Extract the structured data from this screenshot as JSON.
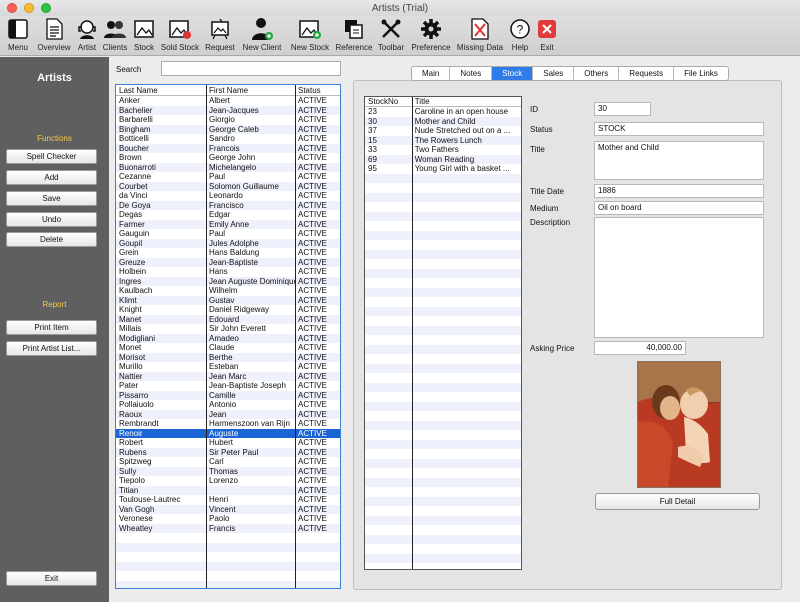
{
  "window": {
    "title": "Artists (Trial)"
  },
  "toolbar": [
    {
      "label": "Menu",
      "icon": "menu-icon"
    },
    {
      "label": "Overview",
      "icon": "overview-icon"
    },
    {
      "label": "Artist",
      "icon": "artist-icon"
    },
    {
      "label": "Clients",
      "icon": "clients-icon"
    },
    {
      "label": "Stock",
      "icon": "stock-icon"
    },
    {
      "label": "Sold Stock",
      "icon": "sold-stock-icon"
    },
    {
      "label": "Request",
      "icon": "request-icon"
    },
    {
      "label": "New Client",
      "icon": "new-client-icon"
    },
    {
      "label": "New Stock",
      "icon": "new-stock-icon"
    },
    {
      "label": "Reference",
      "icon": "reference-icon"
    },
    {
      "label": "Toolbar",
      "icon": "toolbar-icon"
    },
    {
      "label": "Preference",
      "icon": "gear-icon"
    },
    {
      "label": "Missing Data",
      "icon": "missing-data-icon"
    },
    {
      "label": "Help",
      "icon": "help-icon"
    },
    {
      "label": "Exit",
      "icon": "exit-icon"
    }
  ],
  "sidebar": {
    "title": "Artists",
    "functions_label": "Functions",
    "functions": [
      "Spell Checker",
      "Add",
      "Save",
      "Undo",
      "Delete"
    ],
    "report_label": "Report",
    "reports": [
      "Print Item",
      "Print Artist List..."
    ],
    "exit_label": "Exit"
  },
  "search": {
    "label": "Search",
    "value": ""
  },
  "artist_list": {
    "headers": [
      "Last Name",
      "First Name",
      "Status"
    ],
    "selected_index": 35,
    "rows": [
      [
        "Anker",
        "Albert",
        "ACTIVE"
      ],
      [
        "Bachelier",
        "Jean-Jacques",
        "ACTIVE"
      ],
      [
        "Barbarelli",
        "Giorgio",
        "ACTIVE"
      ],
      [
        "Bingham",
        "George Caleb",
        "ACTIVE"
      ],
      [
        "Botticelli",
        "Sandro",
        "ACTIVE"
      ],
      [
        "Boucher",
        "Francois",
        "ACTIVE"
      ],
      [
        "Brown",
        "George John",
        "ACTIVE"
      ],
      [
        "Buonarroti",
        "Michelangelo",
        "ACTIVE"
      ],
      [
        "Cezanne",
        "Paul",
        "ACTIVE"
      ],
      [
        "Courbet",
        "Solomon Guillaume",
        "ACTIVE"
      ],
      [
        "da Vinci",
        "Leonardo",
        "ACTIVE"
      ],
      [
        "De Goya",
        "Francisco",
        "ACTIVE"
      ],
      [
        "Degas",
        "Edgar",
        "ACTIVE"
      ],
      [
        "Farmer",
        "Emily Anne",
        "ACTIVE"
      ],
      [
        "Gauguin",
        "Paul",
        "ACTIVE"
      ],
      [
        "Goupil",
        "Jules Adolphe",
        "ACTIVE"
      ],
      [
        "Grein",
        "Hans Baldung",
        "ACTIVE"
      ],
      [
        "Greuze",
        "Jean-Baptiste",
        "ACTIVE"
      ],
      [
        "Holbein",
        "Hans",
        "ACTIVE"
      ],
      [
        "Ingres",
        "Jean Auguste Dominique",
        "ACTIVE"
      ],
      [
        "Kaulbach",
        "Wilhelm",
        "ACTIVE"
      ],
      [
        "Klimt",
        "Gustav",
        "ACTIVE"
      ],
      [
        "Knight",
        "Daniel Ridgeway",
        "ACTIVE"
      ],
      [
        "Manet",
        "Edouard",
        "ACTIVE"
      ],
      [
        "Millais",
        "Sir John Everett",
        "ACTIVE"
      ],
      [
        "Modigliani",
        "Amadeo",
        "ACTIVE"
      ],
      [
        "Monet",
        "Claude",
        "ACTIVE"
      ],
      [
        "Morisot",
        "Berthe",
        "ACTIVE"
      ],
      [
        "Murillo",
        "Esteban",
        "ACTIVE"
      ],
      [
        "Nattier",
        "Jean Marc",
        "ACTIVE"
      ],
      [
        "Pater",
        "Jean-Baptiste Joseph",
        "ACTIVE"
      ],
      [
        "Pissarro",
        "Camille",
        "ACTIVE"
      ],
      [
        "Pollaiuolo",
        "Antonio",
        "ACTIVE"
      ],
      [
        "Raoux",
        "Jean",
        "ACTIVE"
      ],
      [
        "Rembrandt",
        "Harmenszoon van Rijn",
        "ACTIVE"
      ],
      [
        "Renoir",
        "Auguste",
        "ACTIVE"
      ],
      [
        "Robert",
        "Hubert",
        "ACTIVE"
      ],
      [
        "Rubens",
        "Sir Peter Paul",
        "ACTIVE"
      ],
      [
        "Spitzweg",
        "Carl",
        "ACTIVE"
      ],
      [
        "Sully",
        "Thomas",
        "ACTIVE"
      ],
      [
        "Tiepolo",
        "Lorenzo",
        "ACTIVE"
      ],
      [
        "Titian",
        "",
        "ACTIVE"
      ],
      [
        "Toulouse-Lautrec",
        "Henri",
        "ACTIVE"
      ],
      [
        "Van Gogh",
        "Vincent",
        "ACTIVE"
      ],
      [
        "Veronese",
        "Paolo",
        "ACTIVE"
      ],
      [
        "Wheatley",
        "Francis",
        "ACTIVE"
      ]
    ]
  },
  "tabs": [
    "Main",
    "Notes",
    "Stock",
    "Sales",
    "Others",
    "Requests",
    "File Links"
  ],
  "active_tab": 2,
  "stock_list": {
    "headers": [
      "StockNo",
      "Title"
    ],
    "rows": [
      [
        "23",
        "Caroline in an open house"
      ],
      [
        "30",
        "Mother and Child"
      ],
      [
        "37",
        "Nude Stretched out on a ..."
      ],
      [
        "15",
        "The Rowers Lunch"
      ],
      [
        "33",
        "Two Fathers"
      ],
      [
        "69",
        "Woman Reading"
      ],
      [
        "95",
        "Young Girl with a basket ..."
      ]
    ]
  },
  "detail": {
    "id_label": "ID",
    "id": "30",
    "status_label": "Status",
    "status": "STOCK",
    "title_label": "Title",
    "title": "Mother and Child",
    "title_date_label": "Title Date",
    "title_date": "1886",
    "medium_label": "Medium",
    "medium": "Oil on board",
    "description_label": "Description",
    "description": "",
    "asking_price_label": "Asking Price",
    "asking_price": "40,000.00",
    "full_detail_label": "Full Detail"
  }
}
